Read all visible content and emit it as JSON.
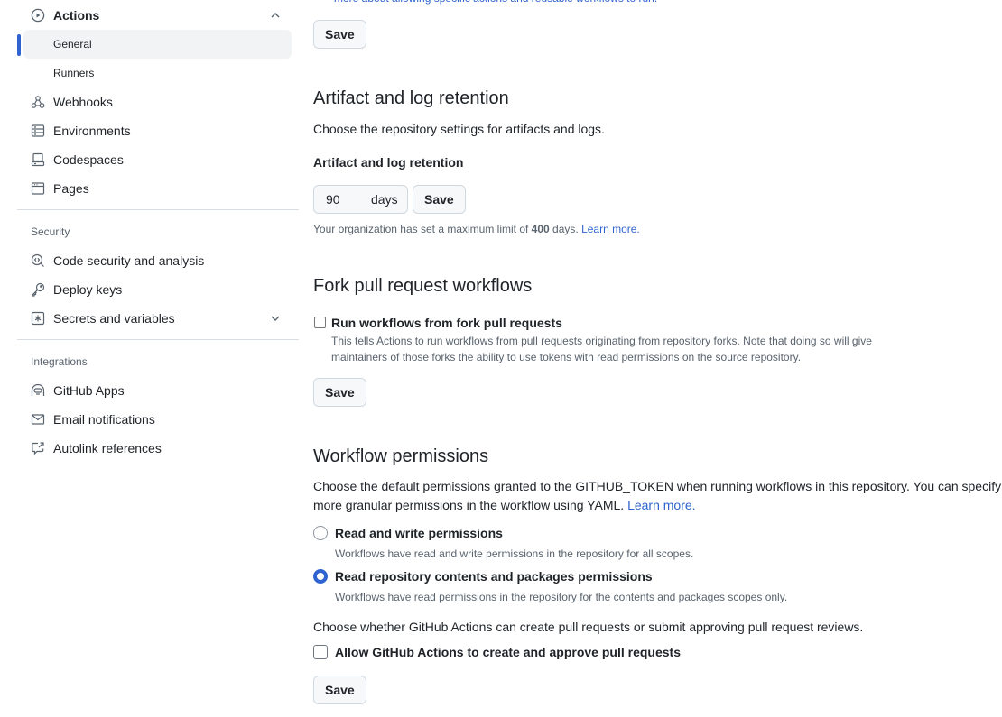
{
  "sidebar": {
    "actions": {
      "label": "Actions",
      "icon": "play-icon",
      "expanded": true,
      "children": [
        {
          "label": "General",
          "active": true
        },
        {
          "label": "Runners",
          "active": false
        }
      ]
    },
    "items_top": [
      {
        "label": "Webhooks",
        "icon": "webhook-icon"
      },
      {
        "label": "Environments",
        "icon": "server-icon"
      },
      {
        "label": "Codespaces",
        "icon": "codespaces-icon"
      },
      {
        "label": "Pages",
        "icon": "browser-icon"
      }
    ],
    "security": {
      "heading": "Security",
      "items": [
        {
          "label": "Code security and analysis",
          "icon": "codescan-icon"
        },
        {
          "label": "Deploy keys",
          "icon": "key-icon"
        },
        {
          "label": "Secrets and variables",
          "icon": "key-asterisk-icon",
          "expandable": true
        }
      ]
    },
    "integrations": {
      "heading": "Integrations",
      "items": [
        {
          "label": "GitHub Apps",
          "icon": "hubot-icon"
        },
        {
          "label": "Email notifications",
          "icon": "mail-icon"
        },
        {
          "label": "Autolink references",
          "icon": "cross-reference-icon"
        }
      ]
    }
  },
  "main": {
    "top": {
      "cut_text": "more about allowing specific actions and reusable workflows to run.",
      "save_label": "Save"
    },
    "artifact": {
      "title": "Artifact and log retention",
      "description": "Choose the repository settings for artifacts and logs.",
      "field_label": "Artifact and log retention",
      "value": "90",
      "suffix": "days",
      "save_label": "Save",
      "note_prefix": "Your organization has set a maximum limit of ",
      "note_limit": "400",
      "note_suffix": " days. ",
      "note_link": "Learn more."
    },
    "fork": {
      "title": "Fork pull request workflows",
      "checkbox_label": "Run workflows from fork pull requests",
      "checked": false,
      "description": "This tells Actions to run workflows from pull requests originating from repository forks. Note that doing so will give maintainers of those forks the ability to use tokens with read permissions on the source repository.",
      "save_label": "Save"
    },
    "permissions": {
      "title": "Workflow permissions",
      "description": "Choose the default permissions granted to the GITHUB_TOKEN when running workflows in this repository. You can specify more granular permissions in the workflow using YAML. ",
      "description_link": "Learn more.",
      "options": [
        {
          "label": "Read and write permissions",
          "description": "Workflows have read and write permissions in the repository for all scopes.",
          "selected": false
        },
        {
          "label": "Read repository contents and packages permissions",
          "description": "Workflows have read permissions in the repository for the contents and packages scopes only.",
          "selected": true
        }
      ],
      "pr_description": "Choose whether GitHub Actions can create pull requests or submit approving pull request reviews.",
      "pr_checkbox_label": "Allow GitHub Actions to create and approve pull requests",
      "pr_checked": false,
      "save_label": "Save"
    }
  },
  "colors": {
    "accent": "#2f63d0",
    "muted_text": "#59636e",
    "button_bg": "#f6f8fa",
    "border": "#d1d9e0"
  }
}
